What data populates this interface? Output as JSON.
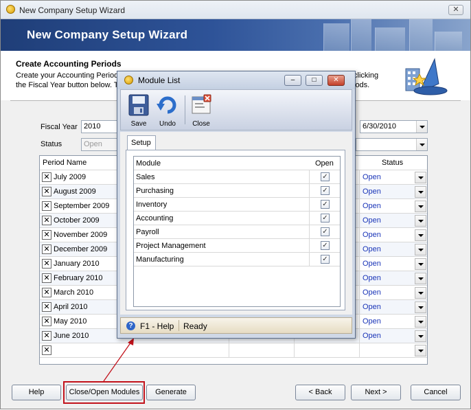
{
  "window": {
    "title": "New Company Setup Wizard",
    "close_label": "✕"
  },
  "banner": {
    "title": "New Company Setup Wizard"
  },
  "section": {
    "title": "Create Accounting Periods",
    "description_left": "Create your Accounting Period",
    "description_left2": "the Fiscal Year button below. T",
    "description_right": "clicking",
    "description_right2": "iods."
  },
  "form": {
    "fiscal_year_label": "Fiscal Year",
    "fiscal_year_value": "2010",
    "end_date_value": "6/30/2010",
    "status_label": "Status",
    "status_value": "Open"
  },
  "grid": {
    "col_period": "Period Name",
    "col_status": "Status",
    "rows": [
      {
        "name": "July 2009",
        "status": "Open"
      },
      {
        "name": "August 2009",
        "status": "Open"
      },
      {
        "name": "September 2009",
        "status": "Open"
      },
      {
        "name": "October 2009",
        "status": "Open"
      },
      {
        "name": "November 2009",
        "status": "Open"
      },
      {
        "name": "December 2009",
        "status": "Open"
      },
      {
        "name": "January 2010",
        "status": "Open"
      },
      {
        "name": "February 2010",
        "status": "Open"
      },
      {
        "name": "March 2010",
        "status": "Open"
      },
      {
        "name": "April 2010",
        "status": "Open"
      },
      {
        "name": "May 2010",
        "status": "Open"
      },
      {
        "name": "June 2010",
        "status": "Open"
      }
    ],
    "delete_glyph": "✕"
  },
  "buttons": {
    "help": "Help",
    "close_open_modules": "Close/Open Modules",
    "generate": "Generate",
    "back": "< Back",
    "next": "Next >",
    "cancel": "Cancel"
  },
  "modal": {
    "title": "Module List",
    "toolbar": {
      "save": "Save",
      "undo": "Undo",
      "close": "Close"
    },
    "tab": "Setup",
    "col_module": "Module",
    "col_open": "Open",
    "modules": [
      {
        "name": "Sales",
        "open": true
      },
      {
        "name": "Purchasing",
        "open": true
      },
      {
        "name": "Inventory",
        "open": true
      },
      {
        "name": "Accounting",
        "open": true
      },
      {
        "name": "Payroll",
        "open": true
      },
      {
        "name": "Project Management",
        "open": true
      },
      {
        "name": "Manufacturing",
        "open": true
      }
    ],
    "check_glyph": "✓",
    "status_help": "F1 - Help",
    "status_text": "Ready"
  },
  "colors": {
    "highlight": "#c2121b",
    "link": "#1a35b8",
    "banner": "#2e5398"
  }
}
